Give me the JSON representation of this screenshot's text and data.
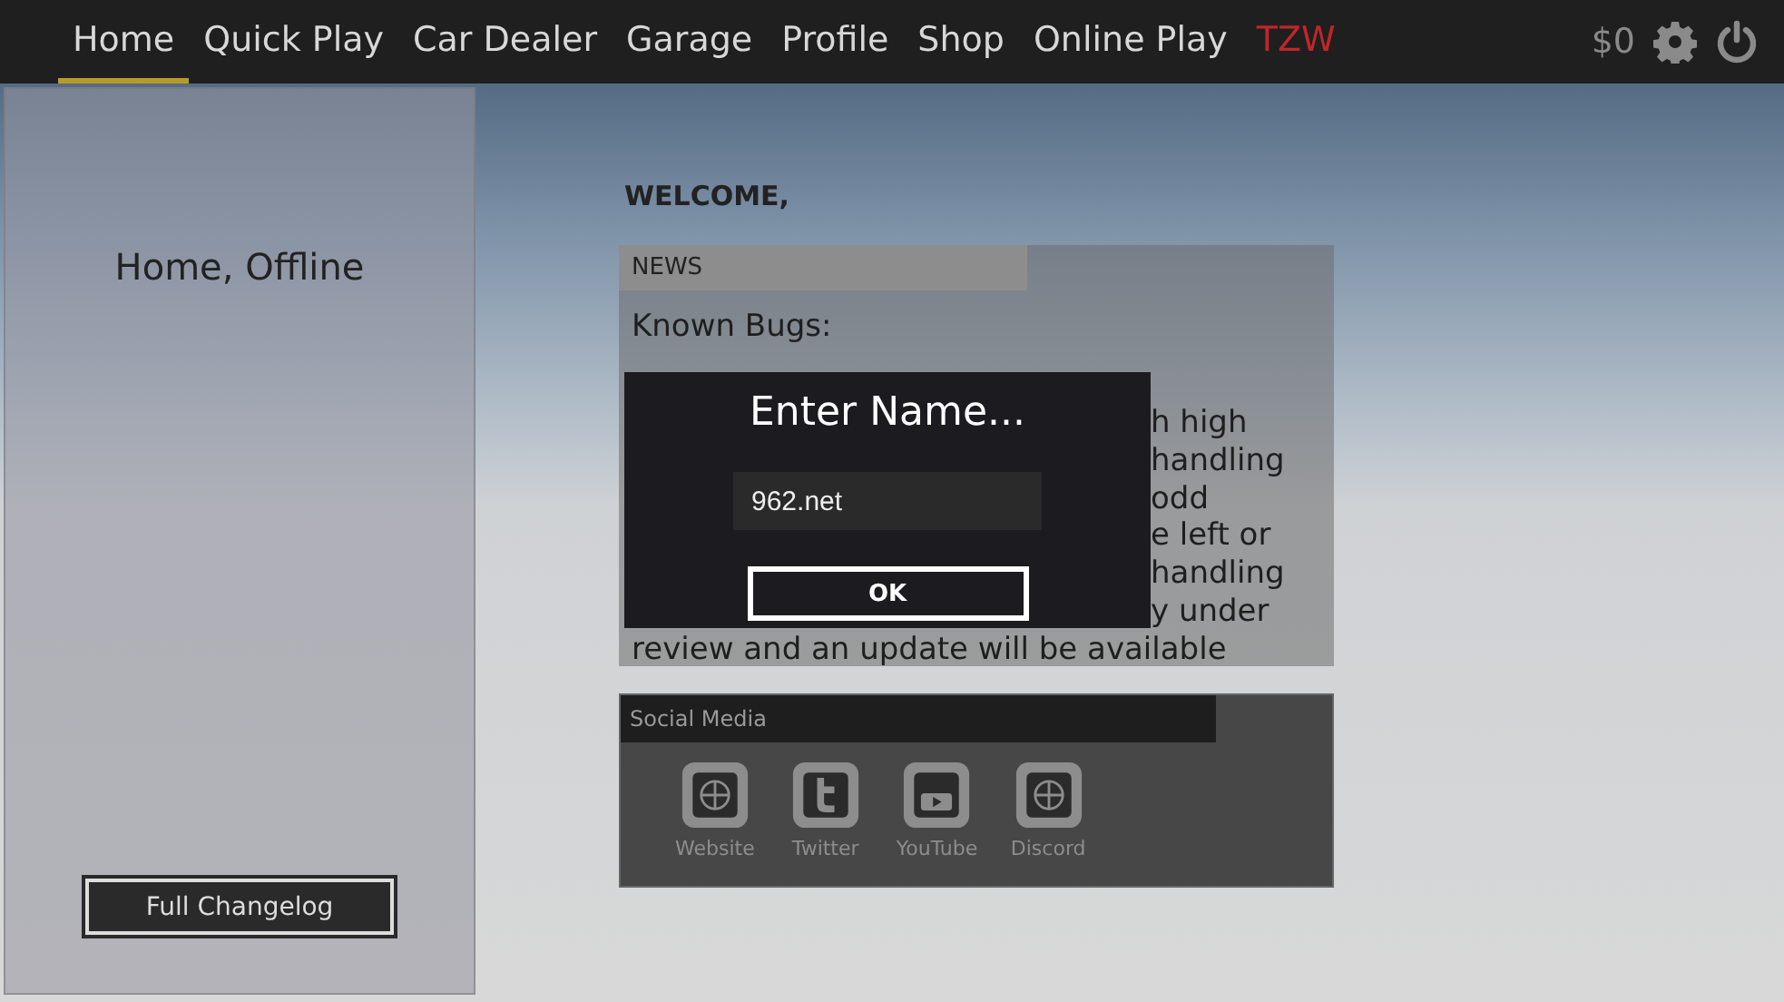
{
  "nav": {
    "tabs": [
      {
        "label": "Home",
        "selected": true,
        "color": "#d8d8d8"
      },
      {
        "label": "Quick Play",
        "selected": false,
        "color": "#d8d8d8"
      },
      {
        "label": "Car Dealer",
        "selected": false,
        "color": "#d8d8d8"
      },
      {
        "label": "Garage",
        "selected": false,
        "color": "#d8d8d8"
      },
      {
        "label": "Profile",
        "selected": false,
        "color": "#d8d8d8"
      },
      {
        "label": "Shop",
        "selected": false,
        "color": "#d8d8d8"
      },
      {
        "label": "Online Play",
        "selected": false,
        "color": "#d8d8d8"
      },
      {
        "label": "TZW",
        "selected": false,
        "color": "#c0262a"
      }
    ],
    "money": "$0"
  },
  "sidebar": {
    "title": "Home, Offline",
    "button": "Full Changelog"
  },
  "welcome": "WELCOME,",
  "news": {
    "title": "NEWS",
    "heading": "Known Bugs:",
    "covered_lines": [
      "h high",
      "handling",
      "odd",
      "e left or",
      "handling",
      "y under"
    ],
    "last_line": "review and an update will be available"
  },
  "social": {
    "title": "Social Media",
    "links": [
      {
        "label": "Website",
        "kind": "www"
      },
      {
        "label": "Twitter",
        "kind": "twitter"
      },
      {
        "label": "YouTube",
        "kind": "youtube"
      },
      {
        "label": "Discord",
        "kind": "www"
      }
    ]
  },
  "dialog": {
    "title": "Enter Name...",
    "value": "962.net",
    "button": "OK"
  }
}
